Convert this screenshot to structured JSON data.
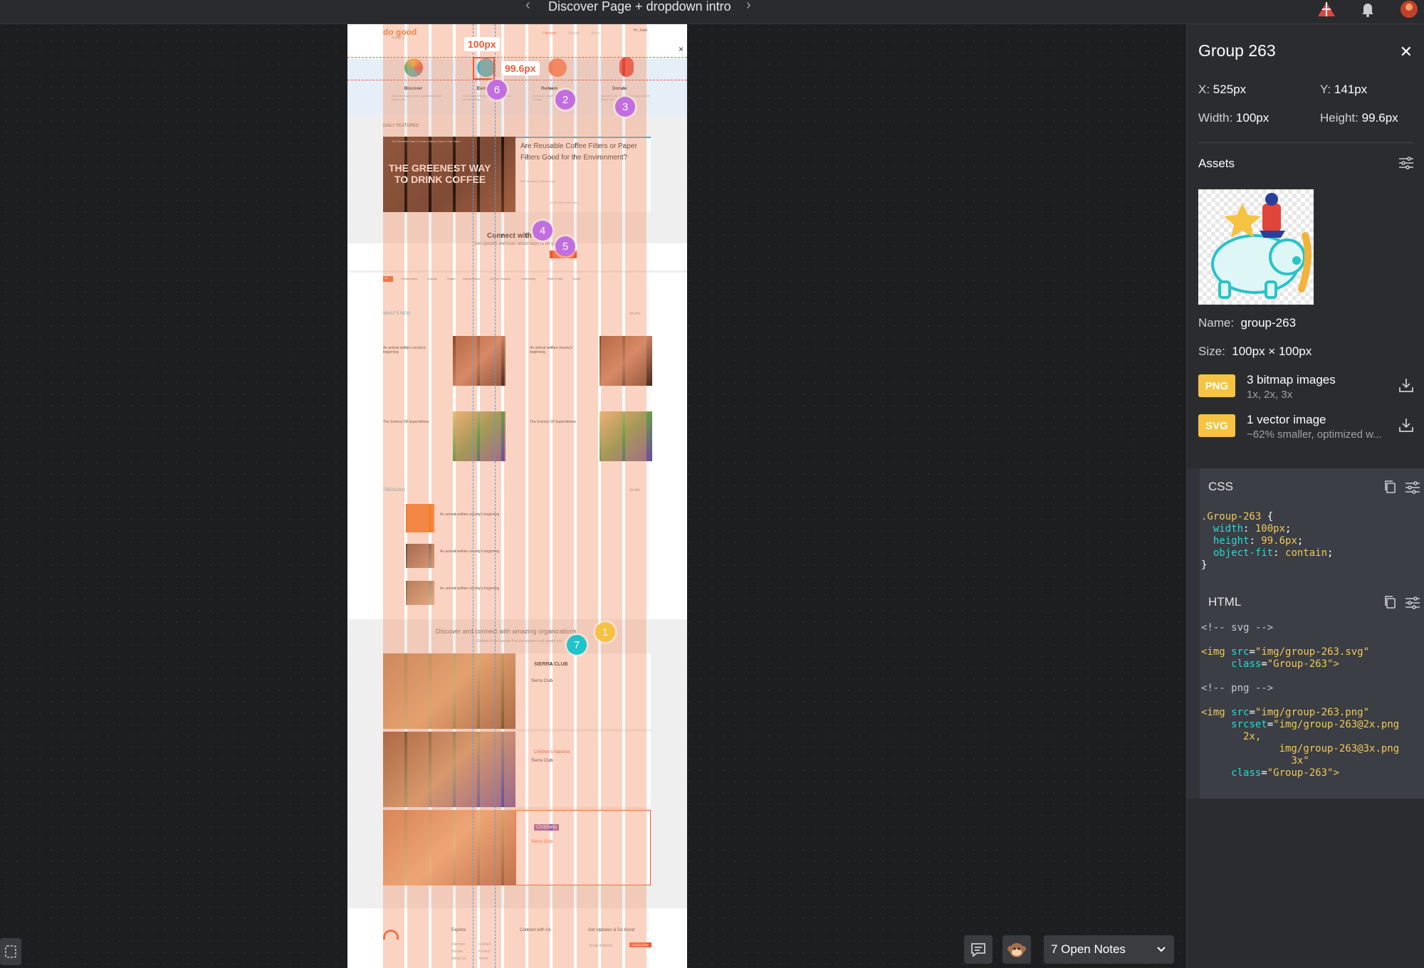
{
  "topbar": {
    "title": "Discover Page + dropdown intro",
    "prev_icon": "chevron-left-icon",
    "next_icon": "chevron-right-icon"
  },
  "artboard": {
    "logo": "do good",
    "logo_sub": "POINTS",
    "nav": [
      "Discover",
      "Donate",
      "About"
    ],
    "user_greeting": "Hi, Josie",
    "intro_steps": [
      {
        "label": "Discover",
        "text": "Discover causes and organizations that inspire you."
      },
      {
        "label": "Earn",
        "text": "Earn Good Points by learning, sharing and donating."
      },
      {
        "label": "Redeem",
        "text": "Use your Good Points to make real change."
      },
      {
        "label": "Donate",
        "text": "Donate to the causes that support and inspire you."
      }
    ],
    "daily_featured_label": "DAILY FEATURED",
    "video_caption": "The Greenest Way To Drink Coffee | Sierra Club Video",
    "video_title_line1": "THE GREENEST WAY",
    "video_title_line2": "TO DRINK COFFEE",
    "featured_title": "Are Reusable Coffee Filters or Paper Filters Good for the Environment?",
    "featured_author": "Bob Grisgins in Sierra Club",
    "featured_likes": "12.2k Liked This Story",
    "connect_title": "Connect with us",
    "connect_sub": "Get updates and learn about ways to do good",
    "filters": [
      "All",
      "Environment",
      "Animals",
      "Health",
      "Humanitarian",
      "Human Services",
      "Community",
      "Public Policy",
      "Social"
    ],
    "whats_new_label": "WHAT'S NEW",
    "shuffle_label": "Shuffle",
    "story_title_a": "An animal welfare society's beginning",
    "story_title_b": "The Science Of Superstitions",
    "trending_label": "TRENDING",
    "orgs_title": "Discover and connect with amazing organizations",
    "orgs_sub": "Donate to the causes that you support and inspire you",
    "org_names": [
      "SIERRA CLUB",
      "Children's National",
      "Childhelp"
    ],
    "org_link": "Sierra Club",
    "footer_cols": [
      "Explore",
      "Connect with Us",
      "Get Updates & Do Good"
    ],
    "footer_explore": [
      "Discover",
      "Donate",
      "About Us"
    ],
    "footer_more": [
      "Contact",
      "Privacy",
      "Terms"
    ],
    "subscribe_label": "SUBSCRIBE",
    "email_placeholder": "Email Address"
  },
  "overlay": {
    "width_tag": "100px",
    "height_tag": "99.6px",
    "badges": [
      {
        "n": "1",
        "color": "#f5c242"
      },
      {
        "n": "2",
        "color": "#c26ee0"
      },
      {
        "n": "3",
        "color": "#c26ee0"
      },
      {
        "n": "4",
        "color": "#c26ee0"
      },
      {
        "n": "5",
        "color": "#c26ee0"
      },
      {
        "n": "6",
        "color": "#c26ee0"
      },
      {
        "n": "7",
        "color": "#1fc3c9"
      }
    ]
  },
  "panel": {
    "title": "Group 263",
    "x_label": "X:",
    "x_value": "525px",
    "y_label": "Y:",
    "y_value": "141px",
    "width_label": "Width:",
    "width_value": "100px",
    "height_label": "Height:",
    "height_value": "99.6px",
    "assets_label": "Assets",
    "name_label": "Name:",
    "name_value": "group-263",
    "size_label": "Size:",
    "size_value": "100px × 100px",
    "png_tag": "PNG",
    "png_main": "3 bitmap images",
    "png_sub": "1x, 2x, 3x",
    "svg_tag": "SVG",
    "svg_main": "1 vector image",
    "svg_sub": "~62% smaller, optimized w...",
    "css_label": "CSS",
    "html_label": "HTML",
    "css_code": {
      "selector": ".Group-263",
      "p1": "width",
      "v1": "100px",
      "p2": "height",
      "v2": "99.6px",
      "p3": "object-fit",
      "v3": "contain"
    },
    "html_code": {
      "c1": "<!-- svg -->",
      "src1": "\"img/group-263.svg\"",
      "class1": "\"Group-263\"",
      "c2": "<!-- png -->",
      "src2": "\"img/group-263.png\"",
      "srcset_a": "\"img/group-263@2x.png",
      "srcset_b": "2x,",
      "srcset_c": "img/group-263@3x.png",
      "srcset_d": "3x\"",
      "class2": "\"Group-263\""
    }
  },
  "bottom": {
    "notes_label": "7 Open Notes"
  },
  "colors": {
    "accent_orange": "#ef5a33",
    "badge_purple": "#c26ee0",
    "badge_yellow": "#f5c242",
    "badge_teal": "#1fc3c9",
    "tag_yellow": "#f6c343"
  }
}
